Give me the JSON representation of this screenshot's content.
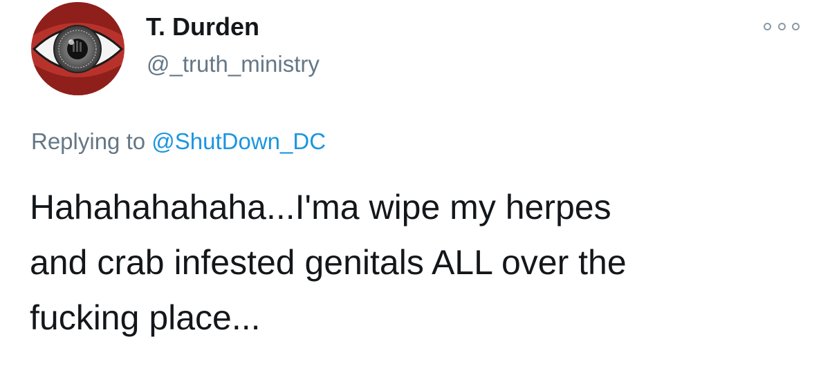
{
  "author": {
    "display_name": "T. Durden",
    "handle": "@_truth_ministry",
    "avatar_icon": "eye-avatar-icon"
  },
  "more_icon": "more-options-icon",
  "reply": {
    "prefix": "Replying to",
    "mention": "@ShutDown_DC"
  },
  "tweet": {
    "lines": [
      "Hahahahahaha...I'ma wipe my herpes",
      "and crab infested genitals ALL over the",
      "fucking place..."
    ]
  },
  "colors": {
    "text_primary": "#14171a",
    "text_secondary": "#657786",
    "link": "#1b95e0",
    "icon_gray": "#8899a6"
  }
}
